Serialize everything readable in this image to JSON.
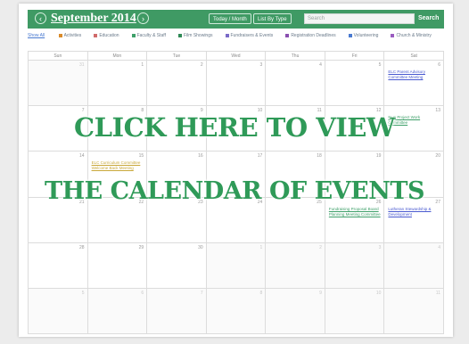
{
  "header": {
    "prev_icon": "chevron-left-icon",
    "next_icon": "chevron-right-icon",
    "month_title": "September 2014",
    "btn_this_month": "Today / Month",
    "btn_list": "List By Type",
    "search_placeholder": "Search",
    "search_btn": "Search"
  },
  "legend": {
    "show_all": "Show All",
    "items": [
      {
        "label": "Activities",
        "color": "#d98b2b"
      },
      {
        "label": "Education",
        "color": "#d06b6b"
      },
      {
        "label": "Faculty & Staff",
        "color": "#3fa06a"
      },
      {
        "label": "Film Showings",
        "color": "#2f8a56"
      },
      {
        "label": "Fundraisers & Events",
        "color": "#7a6ac8"
      },
      {
        "label": "Registration Deadlines",
        "color": "#8a4fb0"
      },
      {
        "label": "Volunteering",
        "color": "#4a7ad0"
      },
      {
        "label": "Church & Ministry",
        "color": "#9a5cc0"
      }
    ]
  },
  "weekdays": [
    "Sun",
    "Mon",
    "Tue",
    "Wed",
    "Thu",
    "Fri",
    "Sat"
  ],
  "weeks": [
    [
      {
        "d": "31",
        "o": true
      },
      {
        "d": "1"
      },
      {
        "d": "2"
      },
      {
        "d": "3"
      },
      {
        "d": "4"
      },
      {
        "d": "5"
      },
      {
        "d": "6",
        "e": "ELC Parent Advisory Committee Meeting",
        "c": "#4a5ad0"
      }
    ],
    [
      {
        "d": "7"
      },
      {
        "d": "8"
      },
      {
        "d": "9"
      },
      {
        "d": "10"
      },
      {
        "d": "11"
      },
      {
        "d": "12"
      },
      {
        "d": "13",
        "e": "ELC Project Work Committee",
        "c": "#3fa06a"
      }
    ],
    [
      {
        "d": "14"
      },
      {
        "d": "15",
        "e": "ELC Curriculum Committee Welcome Back Meeting",
        "c": "#c9a83a"
      },
      {
        "d": "16"
      },
      {
        "d": "17"
      },
      {
        "d": "18"
      },
      {
        "d": "19"
      },
      {
        "d": "20"
      }
    ],
    [
      {
        "d": "21"
      },
      {
        "d": "22"
      },
      {
        "d": "23"
      },
      {
        "d": "24"
      },
      {
        "d": "25"
      },
      {
        "d": "26",
        "e": "Fundraising Proposal Board Planning Meeting Committee",
        "c": "#3fa06a"
      },
      {
        "d": "27",
        "e": "Lutheran Stewardship & Development",
        "c": "#4a5ad0"
      }
    ],
    [
      {
        "d": "28"
      },
      {
        "d": "29"
      },
      {
        "d": "30"
      },
      {
        "d": "1",
        "o": true
      },
      {
        "d": "2",
        "o": true
      },
      {
        "d": "3",
        "o": true
      },
      {
        "d": "4",
        "o": true
      }
    ],
    [
      {
        "d": "5",
        "o": true
      },
      {
        "d": "6",
        "o": true
      },
      {
        "d": "7",
        "o": true
      },
      {
        "d": "8",
        "o": true
      },
      {
        "d": "9",
        "o": true
      },
      {
        "d": "10",
        "o": true
      },
      {
        "d": "11",
        "o": true
      }
    ]
  ],
  "overlay": {
    "line1": "CLICK HERE TO VIEW",
    "line2": "THE CALENDAR OF EVENTS"
  },
  "colors": {
    "header_green": "#3f9a64",
    "overlay_green": "#2f9a58"
  }
}
